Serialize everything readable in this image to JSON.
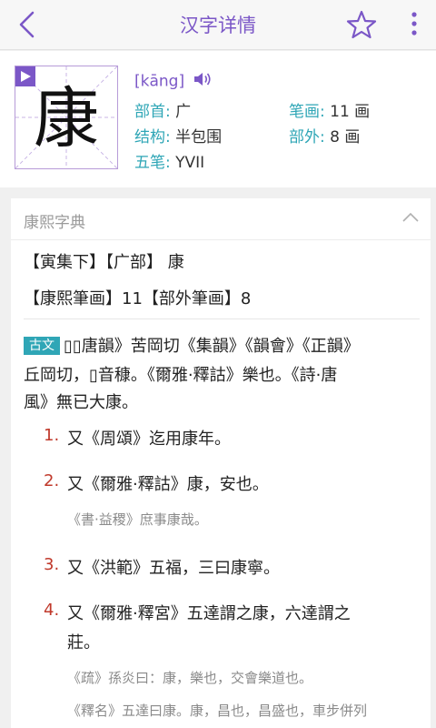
{
  "header": {
    "title": "汉字详情",
    "back_icon": "chevron-left-icon",
    "star_icon": "star-outline-icon",
    "more_icon": "more-vertical-icon"
  },
  "character": {
    "glyph": "康",
    "pinyin": "[kāng]",
    "fields": {
      "radical_label": "部首:",
      "radical_value": "广",
      "strokes_label": "笔画:",
      "strokes_value": "11 画",
      "structure_label": "结构:",
      "structure_value": "半包围",
      "extra_strokes_label": "部外:",
      "extra_strokes_value": "8 画",
      "wubi_label": "五笔:",
      "wubi_value": "YVII"
    }
  },
  "kangxi": {
    "title": "康熙字典",
    "line1": "【寅集下】【广部】 康",
    "line2": "【康熙筆画】11【部外筆画】8",
    "badge": "古文",
    "para1_l1": "▯▯唐韻》苦岡切《集韻》《韻會》《正韻》",
    "para1_l2": "丘岡切，▯音穅。《爾雅·釋詁》樂也。《詩·唐",
    "para1_l3": "風》無已大康。",
    "items": [
      {
        "num": "1.",
        "text": "又《周頌》迄用康年。"
      },
      {
        "num": "2.",
        "text": "又《爾雅·釋詁》康，安也。",
        "quote": "《書·益稷》庶事康哉。"
      },
      {
        "num": "3.",
        "text": "又《洪範》五福，三曰康寧。"
      },
      {
        "num": "4.",
        "text": "又《爾雅·釋宮》五達謂之康，六達謂之",
        "text2": "莊。",
        "quote": "《疏》孫炎曰：康，樂也，交會樂道也。",
        "quote2": "《釋名》五達曰康。康，昌也，昌盛也，車步併列"
      }
    ]
  },
  "colors": {
    "accent": "#7b57c7",
    "label": "#2fa6b6",
    "number": "#c0392b"
  }
}
